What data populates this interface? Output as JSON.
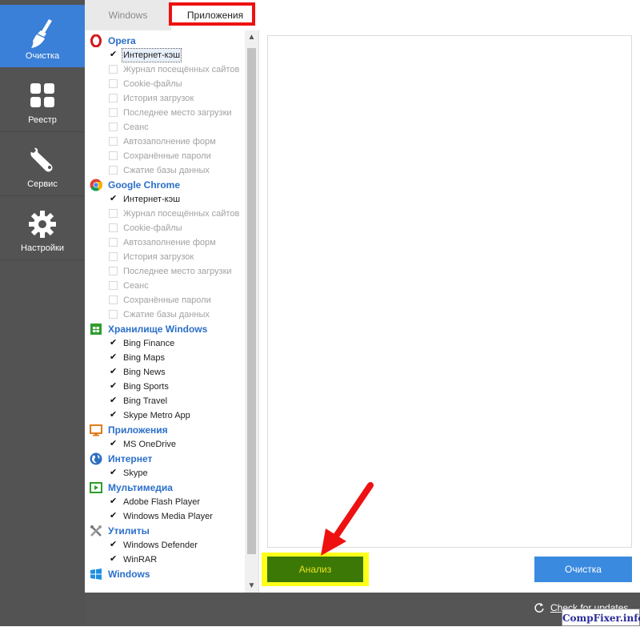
{
  "sidebar": {
    "items": [
      {
        "label": "Очистка",
        "icon": "broom-icon"
      },
      {
        "label": "Реестр",
        "icon": "grid-icon"
      },
      {
        "label": "Сервис",
        "icon": "wrench-icon"
      },
      {
        "label": "Настройки",
        "icon": "gear-icon"
      }
    ]
  },
  "tabs": {
    "windows": "Windows",
    "apps": "Приложения"
  },
  "list": {
    "groups": [
      {
        "name": "Opera",
        "icon": "opera-icon",
        "items": [
          {
            "label": "Интернет-кэш",
            "checked": true
          },
          {
            "label": "Журнал посещённых сайтов",
            "checked": false
          },
          {
            "label": "Cookie-файлы",
            "checked": false
          },
          {
            "label": "История загрузок",
            "checked": false
          },
          {
            "label": "Последнее место загрузки",
            "checked": false
          },
          {
            "label": "Сеанс",
            "checked": false
          },
          {
            "label": "Автозаполнение форм",
            "checked": false
          },
          {
            "label": "Сохранённые пароли",
            "checked": false
          },
          {
            "label": "Сжатие базы данных",
            "checked": false
          }
        ]
      },
      {
        "name": "Google Chrome",
        "icon": "chrome-icon",
        "items": [
          {
            "label": "Интернет-кэш",
            "checked": true
          },
          {
            "label": "Журнал посещённых сайтов",
            "checked": false
          },
          {
            "label": "Cookie-файлы",
            "checked": false
          },
          {
            "label": "Автозаполнение форм",
            "checked": false
          },
          {
            "label": "История загрузок",
            "checked": false
          },
          {
            "label": "Последнее место загрузки",
            "checked": false
          },
          {
            "label": "Сеанс",
            "checked": false
          },
          {
            "label": "Сохранённые пароли",
            "checked": false
          },
          {
            "label": "Сжатие базы данных",
            "checked": false
          }
        ]
      },
      {
        "name": "Хранилище Windows",
        "icon": "windows-store-icon",
        "items": [
          {
            "label": "Bing Finance",
            "checked": true
          },
          {
            "label": "Bing Maps",
            "checked": true
          },
          {
            "label": "Bing News",
            "checked": true
          },
          {
            "label": "Bing Sports",
            "checked": true
          },
          {
            "label": "Bing Travel",
            "checked": true
          },
          {
            "label": "Skype Metro App",
            "checked": true
          }
        ]
      },
      {
        "name": "Приложения",
        "icon": "monitor-icon",
        "items": [
          {
            "label": "MS OneDrive",
            "checked": true
          }
        ]
      },
      {
        "name": "Интернет",
        "icon": "globe-icon",
        "items": [
          {
            "label": "Skype",
            "checked": true
          }
        ]
      },
      {
        "name": "Мультимедиа",
        "icon": "media-icon",
        "items": [
          {
            "label": "Adobe Flash Player",
            "checked": true
          },
          {
            "label": "Windows Media Player",
            "checked": true
          }
        ]
      },
      {
        "name": "Утилиты",
        "icon": "tools-icon",
        "items": [
          {
            "label": "Windows Defender",
            "checked": true
          },
          {
            "label": "WinRAR",
            "checked": true
          }
        ]
      },
      {
        "name": "Windows",
        "icon": "windows-logo-icon",
        "items": []
      }
    ]
  },
  "buttons": {
    "analyze": "Анализ",
    "clean": "Очистка"
  },
  "footer": {
    "update_link": "Check for updates"
  },
  "watermark": "CompFixer.info",
  "colors": {
    "sidebar_bg": "#535353",
    "sidebar_active": "#3a7fd8",
    "group_title": "#2b6fc9",
    "analyze_bg": "#3b7806",
    "analyze_text": "#e8e21a",
    "clean_bg": "#3a8ae0",
    "highlight_red": "#ee1111",
    "highlight_yellow": "#ffff1a"
  }
}
